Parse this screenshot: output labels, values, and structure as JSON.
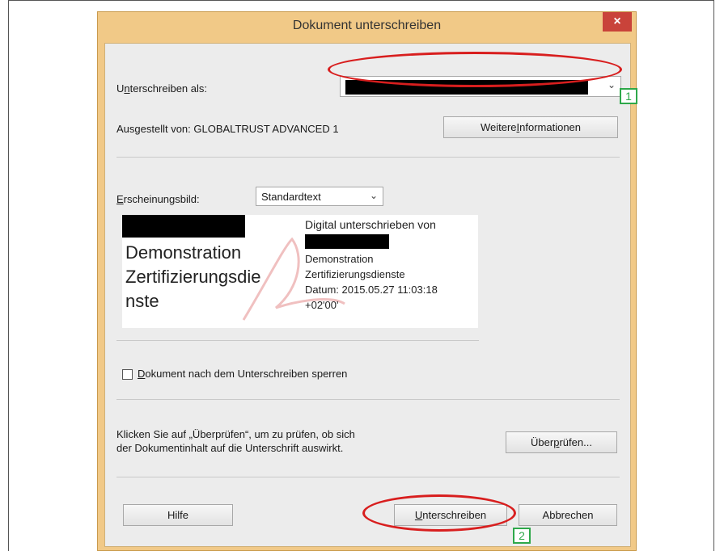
{
  "dialog": {
    "title": "Dokument unterschreiben",
    "close_glyph": "×"
  },
  "sign_as": {
    "label_first": "U",
    "label_u": "n",
    "label_rest": "terschreiben als:",
    "dropdown_value_redacted": true,
    "chevron": "⌄"
  },
  "issuer": {
    "text": "Ausgestellt von: GLOBALTRUST ADVANCED 1",
    "more_info_prefix": "Weitere ",
    "more_info_u": "I",
    "more_info_rest": "nformationen"
  },
  "appearance": {
    "label_u": "E",
    "label_rest": "rscheinungsbild:",
    "selected": "Standardtext",
    "chevron": "⌄"
  },
  "preview": {
    "left_line1": "Demonstration",
    "left_line2": "Zertifizierungsdie",
    "left_line3": "nste",
    "right_line1": "Digital unterschrieben von",
    "right_line2": "Demonstration",
    "right_line3": "Zertifizierungsdienste",
    "right_line4": "Datum: 2015.05.27 11:03:18",
    "right_line5": "+02'00'"
  },
  "lock": {
    "label_u": "D",
    "label_rest": "okument nach dem Unterschreiben sperren",
    "checked": false
  },
  "review": {
    "line1": "Klicken Sie auf „Überprüfen“, um zu prüfen, ob sich",
    "line2": "der Dokumentinhalt auf die Unterschrift auswirkt.",
    "button_prefix": "Über",
    "button_u": "p",
    "button_rest": "rüfen..."
  },
  "footer": {
    "help": "Hilfe",
    "sign_u": "U",
    "sign_rest": "nterschreiben",
    "cancel": "Abbrechen"
  },
  "annotations": {
    "marker_1": "1",
    "marker_2": "2",
    "ellipse_color": "#d81e1e",
    "marker_color": "#2ea84a"
  }
}
